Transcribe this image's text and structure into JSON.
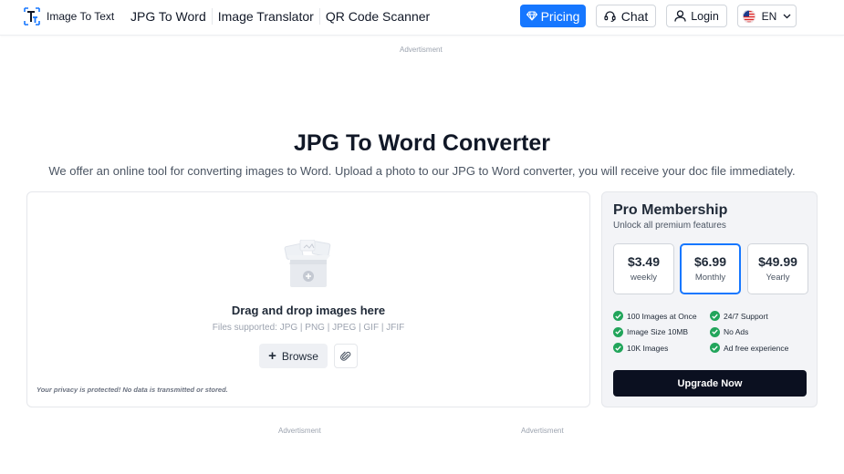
{
  "header": {
    "logo_text": "Image To Text",
    "nav": [
      "JPG To Word",
      "Image Translator",
      "QR Code Scanner"
    ],
    "pricing_label": "Pricing",
    "chat_label": "Chat",
    "login_label": "Login",
    "language": "EN"
  },
  "ads": {
    "top_label": "Advertisment",
    "bottom_left_label": "Advertisment",
    "bottom_right_label": "Advertisment"
  },
  "hero": {
    "title": "JPG To Word Converter",
    "subtitle": "We offer an online tool for converting images to Word. Upload a photo to our JPG to Word converter, you will receive your doc file immediately."
  },
  "upload": {
    "drag_title": "Drag and drop images here",
    "formats": "Files supported: JPG | PNG | JPEG | GIF | JFIF",
    "browse_label": "Browse",
    "privacy_note": "Your privacy is protected! No data is transmitted or stored."
  },
  "pro": {
    "title": "Pro Membership",
    "subtitle": "Unlock all premium features",
    "plans": [
      {
        "price": "$3.49",
        "period": "weekly"
      },
      {
        "price": "$6.99",
        "period": "Monthly"
      },
      {
        "price": "$49.99",
        "period": "Yearly"
      }
    ],
    "selected_plan": 1,
    "features_left": [
      "100 Images at Once",
      "Image Size 10MB",
      "10K Images"
    ],
    "features_right": [
      "24/7 Support",
      "No Ads",
      "Ad free experience"
    ],
    "upgrade_label": "Upgrade Now"
  },
  "colors": {
    "accent": "#1677ff",
    "check": "#22a55b",
    "upgrade_bg": "#0b1020"
  },
  "icons": {
    "pricing": "diamond-icon",
    "chat": "headset-icon",
    "login": "user-icon",
    "language_flag": "us-flag-icon",
    "language_toggle": "chevron-down-icon",
    "browse": "plus-icon",
    "attach": "paperclip-icon",
    "feature": "check-circle-icon"
  }
}
